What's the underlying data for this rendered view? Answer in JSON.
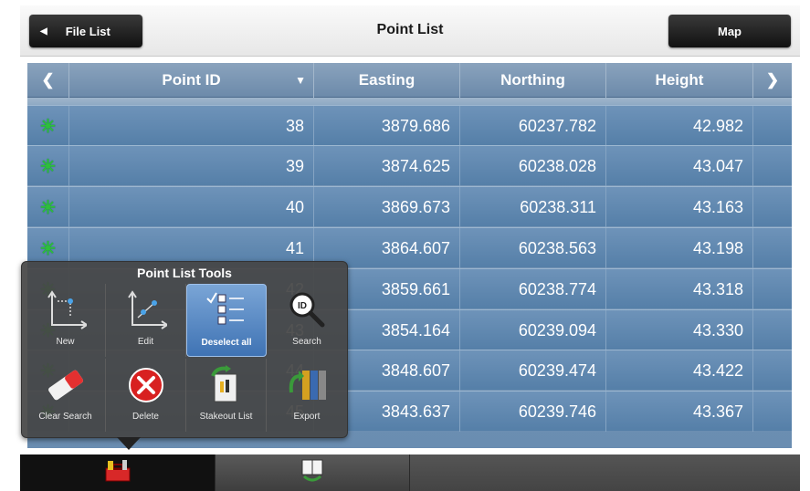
{
  "header": {
    "back_label": "File List",
    "title": "Point List",
    "map_label": "Map"
  },
  "table": {
    "prev_arrow": "❮",
    "next_arrow": "❯",
    "columns": [
      "Point ID",
      "Easting",
      "Northing",
      "Height"
    ],
    "sort_indicator": "▼",
    "rows": [
      {
        "id": "38",
        "easting": "3879.686",
        "northing": "60237.782",
        "height": "42.982"
      },
      {
        "id": "39",
        "easting": "3874.625",
        "northing": "60238.028",
        "height": "43.047"
      },
      {
        "id": "40",
        "easting": "3869.673",
        "northing": "60238.311",
        "height": "43.163"
      },
      {
        "id": "41",
        "easting": "3864.607",
        "northing": "60238.563",
        "height": "43.198"
      },
      {
        "id": "42",
        "easting": "3859.661",
        "northing": "60238.774",
        "height": "43.318"
      },
      {
        "id": "43",
        "easting": "3854.164",
        "northing": "60239.094",
        "height": "43.330"
      },
      {
        "id": "44",
        "easting": "3848.607",
        "northing": "60239.474",
        "height": "43.422"
      },
      {
        "id": "45",
        "easting": "3843.637",
        "northing": "60239.746",
        "height": "43.367"
      }
    ],
    "row_icon": "point-marker-icon",
    "row_icon_color": "#2dbf3a"
  },
  "popup": {
    "title": "Point List Tools",
    "tools": [
      {
        "label": "New",
        "icon": "new-point-icon"
      },
      {
        "label": "Edit",
        "icon": "edit-point-icon"
      },
      {
        "label": "Deselect all",
        "icon": "deselect-all-icon",
        "selected": true
      },
      {
        "label": "Search",
        "icon": "search-id-icon"
      },
      {
        "label": "Clear Search",
        "icon": "eraser-icon"
      },
      {
        "label": "Delete",
        "icon": "delete-icon"
      },
      {
        "label": "Stakeout List",
        "icon": "stakeout-list-icon"
      },
      {
        "label": "Export",
        "icon": "export-icon"
      }
    ]
  },
  "bottom_bar": {
    "tabs": [
      {
        "icon": "toolbox-icon",
        "active": true
      },
      {
        "icon": "book-icon",
        "active": false
      },
      {
        "icon": "",
        "active": false
      }
    ]
  },
  "colors": {
    "table_row": "#5f87ad",
    "header_bg": "#eeeeee",
    "selected_tool": "#3f73b4",
    "delete_red": "#d82020"
  }
}
